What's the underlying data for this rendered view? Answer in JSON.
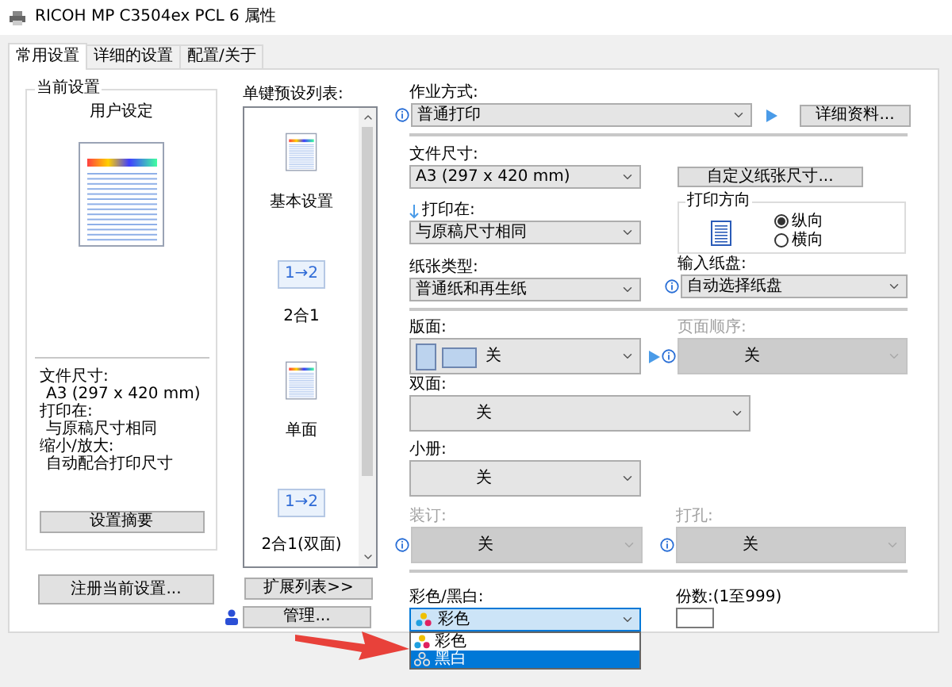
{
  "window": {
    "title": "RICOH MP C3504ex PCL 6 属性"
  },
  "tabs": [
    {
      "label": "常用设置",
      "selected": true
    },
    {
      "label": "详细的设置",
      "selected": false
    },
    {
      "label": "配置/关于",
      "selected": false
    }
  ],
  "current_settings": {
    "legend": "当前设置",
    "name": "用户设定",
    "details": [
      {
        "label": "文件尺寸:",
        "value": "A3 (297 x 420 mm)"
      },
      {
        "label": "打印在:",
        "value": "与原稿尺寸相同"
      },
      {
        "label": "缩小/放大:",
        "value": "自动配合打印尺寸"
      }
    ],
    "summary_button": "设置摘要"
  },
  "register_button": "注册当前设置...",
  "preset_list": {
    "label": "单键预设列表:",
    "items": [
      {
        "label": "基本设置",
        "kind": "page"
      },
      {
        "label": "2合1",
        "kind": "combine",
        "icon_text": "1→2"
      },
      {
        "label": "单面",
        "kind": "page"
      },
      {
        "label": "2合1(双面)",
        "kind": "combine",
        "icon_text": "1→2"
      }
    ],
    "expand_button": "扩展列表>>",
    "manage_button": "管理..."
  },
  "job_type": {
    "label": "作业方式:",
    "value": "普通打印",
    "disabled": false
  },
  "details_button": "详细资料...",
  "document_size": {
    "label": "文件尺寸:",
    "value": "A3 (297 x 420 mm)",
    "disabled": false
  },
  "custom_size_button": "自定义纸张尺寸...",
  "print_on": {
    "label": "打印在:",
    "value": "与原稿尺寸相同",
    "disabled": false
  },
  "orientation": {
    "legend": "打印方向",
    "options": [
      {
        "label": "纵向",
        "selected": true
      },
      {
        "label": "横向",
        "selected": false
      }
    ]
  },
  "paper_type": {
    "label": "纸张类型:",
    "value": "普通纸和再生纸",
    "disabled": false
  },
  "input_tray": {
    "label": "输入纸盘:",
    "value": "自动选择纸盘",
    "disabled": false
  },
  "layout": {
    "label": "版面:",
    "value": "关",
    "disabled": false
  },
  "page_order": {
    "label": "页面顺序:",
    "value": "关",
    "disabled": true
  },
  "duplex": {
    "label": "双面:",
    "value": "关",
    "disabled": false
  },
  "booklet": {
    "label": "小册:",
    "value": "关",
    "disabled": false
  },
  "staple": {
    "label": "装订:",
    "value": "关",
    "disabled": true
  },
  "punch": {
    "label": "打孔:",
    "value": "关",
    "disabled": true
  },
  "color_mode": {
    "label": "彩色/黑白:",
    "value": "彩色",
    "disabled": false,
    "options": [
      {
        "label": "彩色",
        "kind": "color",
        "highlighted": false
      },
      {
        "label": "黑白",
        "kind": "mono",
        "highlighted": true
      }
    ]
  },
  "copies": {
    "label": "份数:(1至999)"
  }
}
